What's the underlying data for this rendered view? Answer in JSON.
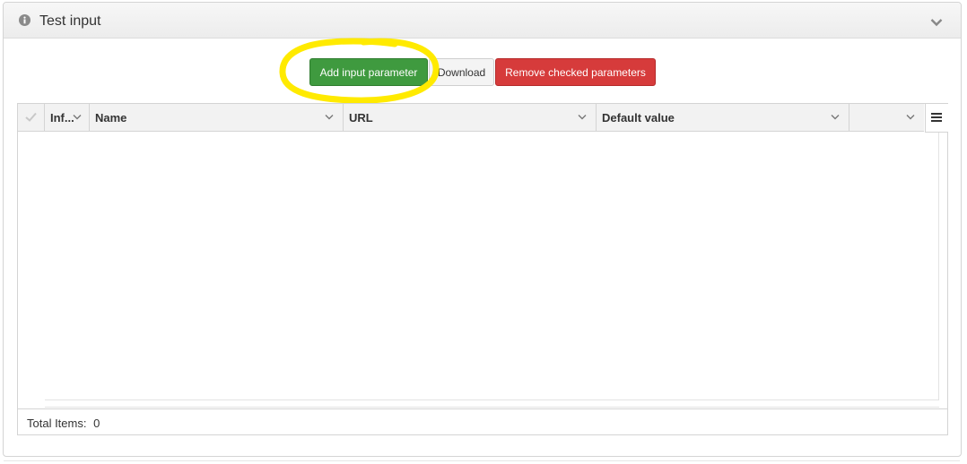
{
  "panel": {
    "title": "Test input",
    "title_icon": "info-circle-icon",
    "collapse_icon": "chevron-down-icon"
  },
  "toolbar": {
    "add_label": "Add input parameter",
    "download_label": "Download",
    "remove_label": "Remove checked parameters"
  },
  "colors": {
    "add": "#3f9a3f",
    "remove": "#d63b3b",
    "highlight": "#ffea00"
  },
  "grid": {
    "columns": [
      {
        "label": "Inf..."
      },
      {
        "label": "Name"
      },
      {
        "label": "URL"
      },
      {
        "label": "Default value"
      },
      {
        "label": ""
      }
    ],
    "rows": [],
    "footer": {
      "total_label": "Total Items:",
      "total_value": "0"
    }
  }
}
